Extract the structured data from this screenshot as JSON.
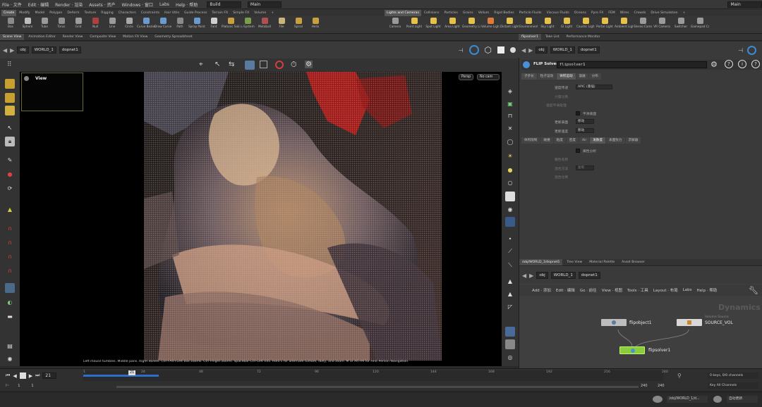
{
  "menubar": {
    "items": [
      "File · 文件",
      "Edit · 编辑",
      "Render · 渲染",
      "Assets · 资产",
      "Windows · 窗口",
      "Labs",
      "Help · 帮助"
    ],
    "desktop": "Build",
    "context": "Main",
    "right_context": "Main"
  },
  "shelf": {
    "tabs_left": [
      "Create",
      "Modify",
      "Model",
      "Polygon",
      "Deform",
      "Texture",
      "Rigging",
      "Characters",
      "Constraints",
      "Hair Utils",
      "Guide Process",
      "Terrain FX",
      "Simple FX",
      "Volume"
    ],
    "tabs_right": [
      "Lights and Cameras",
      "Collisions",
      "Particles",
      "Grains",
      "Vellum",
      "Rigid Bodies",
      "Particle Fluids",
      "Viscous Fluids",
      "Oceans",
      "Pyro FX",
      "FEM",
      "Wires",
      "Crowds",
      "Drive Simulation"
    ],
    "tools_left": [
      {
        "label": "Box",
        "icon": "box-icon",
        "color": "#8a8a8a"
      },
      {
        "label": "Sphere",
        "icon": "sphere-icon",
        "color": "#bdbdbd"
      },
      {
        "label": "Tube",
        "icon": "tube-icon",
        "color": "#9a9a9a"
      },
      {
        "label": "Torus",
        "icon": "torus-icon",
        "color": "#8f8f8f"
      },
      {
        "label": "Grid",
        "icon": "grid-icon",
        "color": "#9d9d9d"
      },
      {
        "label": "Null",
        "icon": "null-icon",
        "color": "#b04040"
      },
      {
        "label": "Line",
        "icon": "line-icon",
        "color": "#9a9a9a"
      },
      {
        "label": "Circle",
        "icon": "circle-icon",
        "color": "#a8a8a8"
      },
      {
        "label": "Curve Bezier",
        "icon": "curve-bezier-icon",
        "color": "#6a9ad0"
      },
      {
        "label": "Draw Curve",
        "icon": "draw-curve-icon",
        "color": "#6a9ad0"
      },
      {
        "label": "Path",
        "icon": "path-icon",
        "color": "#8a8a8a"
      },
      {
        "label": "Spray Paint",
        "icon": "spray-paint-icon",
        "color": "#6a9ad0"
      },
      {
        "label": "Font",
        "icon": "font-icon",
        "color": "#cfcfcf"
      },
      {
        "label": "Platonic Solids",
        "icon": "platonic-solids-icon",
        "color": "#c8a040"
      },
      {
        "label": "L-System",
        "icon": "l-system-icon",
        "color": "#7aa04a"
      },
      {
        "label": "Metaball",
        "icon": "metaball-icon",
        "color": "#b05050"
      },
      {
        "label": "File",
        "icon": "file-icon",
        "color": "#c9b47a"
      },
      {
        "label": "Spiral",
        "icon": "spiral-icon",
        "color": "#c9a040"
      },
      {
        "label": "Helix",
        "icon": "helix-icon",
        "color": "#c9a040"
      }
    ],
    "tools_right": [
      {
        "label": "Camera",
        "icon": "camera-icon",
        "color": "#9a9a9a"
      },
      {
        "label": "Point Light",
        "icon": "point-light-icon",
        "color": "#e6c24a"
      },
      {
        "label": "Spot Light",
        "icon": "spot-light-icon",
        "color": "#e6c24a"
      },
      {
        "label": "Area Light",
        "icon": "area-light-icon",
        "color": "#e6c24a"
      },
      {
        "label": "Geometry Light",
        "icon": "geometry-light-icon",
        "color": "#e6c24a"
      },
      {
        "label": "Volume Light",
        "icon": "volume-light-icon",
        "color": "#e07a3a"
      },
      {
        "label": "Distant Light",
        "icon": "distant-light-icon",
        "color": "#e6c24a"
      },
      {
        "label": "Environment Light",
        "icon": "environment-light-icon",
        "color": "#e6c24a"
      },
      {
        "label": "Sky Light",
        "icon": "sky-light-icon",
        "color": "#e6c24a"
      },
      {
        "label": "GI Light",
        "icon": "gi-light-icon",
        "color": "#e6c24a"
      },
      {
        "label": "Caustic Light",
        "icon": "caustic-light-icon",
        "color": "#e6c24a"
      },
      {
        "label": "Portal Light",
        "icon": "portal-light-icon",
        "color": "#e6c24a"
      },
      {
        "label": "Ambient Light",
        "icon": "ambient-light-icon",
        "color": "#e6c24a"
      },
      {
        "label": "Stereo Camera",
        "icon": "stereo-camera-icon",
        "color": "#9a9a9a"
      },
      {
        "label": "VR Camera",
        "icon": "vr-camera-icon",
        "color": "#9a9a9a"
      },
      {
        "label": "Switcher",
        "icon": "switcher-icon",
        "color": "#9a9a9a"
      },
      {
        "label": "Gamepad Camera",
        "icon": "gamepad-camera-icon",
        "color": "#9a9a9a"
      }
    ]
  },
  "left_pane": {
    "tabs": [
      "Scene View",
      "Animation Editor",
      "Render View",
      "Composite View",
      "Motion FX View",
      "Geometry Spreadsheet"
    ],
    "path_root": "obj",
    "path_1": "WORLD_1",
    "path_2": "dopnet1"
  },
  "viewport": {
    "view_label": "View",
    "persp_button": "Persp",
    "camera_button": "No cam",
    "status_text": "Left mouse tumbles. Middle pans. Right dollies. Ctrl+Alt+Left box zooms. Ctrl+Right zooms. Spacebar-Ctrl-Left tilts. Hold L for alternate tumble, dolly, and zoom. M or Alt+M for First Person Navigation."
  },
  "right_pane": {
    "tabs": [
      "flipsolver1",
      "Take List",
      "Performance Monitor"
    ],
    "path_root": "obj",
    "path_1": "WORLD_1",
    "path_2": "dopnet1",
    "node_type": "FLIP Solver",
    "node_name": "flipsolver1",
    "param_tabs": [
      "子步长",
      "粒子运动",
      "体积运动",
      "容器",
      "分布"
    ],
    "rows": [
      {
        "label": "速度传递",
        "value": "APIC (重插)"
      },
      {
        "label": "力量比例",
        "value": ""
      },
      {
        "label": "速度平滑处理",
        "value": ""
      }
    ],
    "checkbox1": "平滑表面",
    "rows2": [
      {
        "label": "更新表面",
        "value": "移动"
      },
      {
        "label": "更新速度",
        "value": "移动"
      }
    ],
    "sub_tabs": [
      "体积限制",
      "碰撞",
      "粘度",
      "密度",
      "Air",
      "表面张力",
      "求解器"
    ],
    "sub_tab_active": "发散度",
    "checkbox2": "属性分析",
    "rows3": [
      {
        "label": "属性名称",
        "value": ""
      },
      {
        "label": "混合方法",
        "value": "复制"
      },
      {
        "label": "混合比例",
        "value": ""
      }
    ]
  },
  "network": {
    "tabs": [
      "/obj/WORLD_1/dopnet1",
      "Tree View",
      "Material Palette",
      "Asset Browser"
    ],
    "path_root": "obj",
    "path_1": "WORLD_1",
    "path_2": "dopnet1",
    "menu": [
      "Add · 添加",
      "Edit · 编辑",
      "Go · 前往",
      "View · 视图",
      "Tools · 工具",
      "Layout · 布局",
      "Labs",
      "Help · 帮助"
    ],
    "context_label": "Dynamics",
    "nodes": [
      {
        "name": "flipobject1",
        "subtitle": ""
      },
      {
        "name": "SOURCE_VOL",
        "subtitle": "Volume Source"
      },
      {
        "name": "flipsolver1",
        "subtitle": ""
      }
    ]
  },
  "timeline": {
    "current_frame": "21",
    "frame_marker": "21",
    "start": "1",
    "start2": "1",
    "end": "240",
    "end2": "240",
    "ticks": [
      "1",
      "24",
      "48",
      "72",
      "96",
      "120",
      "144",
      "168",
      "192",
      "216",
      "240"
    ],
    "keys_label": "0 keys, 0/0 channels",
    "channels_label": "Key All Channels",
    "cache_fraction": 0.13
  },
  "bottom": {
    "path": "/obj/WORLD_1/d...",
    "update_mode": "自动更新"
  },
  "colors": {
    "accent": "#4a90d9",
    "node_solver": "#8acd3a",
    "cache_bar": "#2e6fcc"
  }
}
